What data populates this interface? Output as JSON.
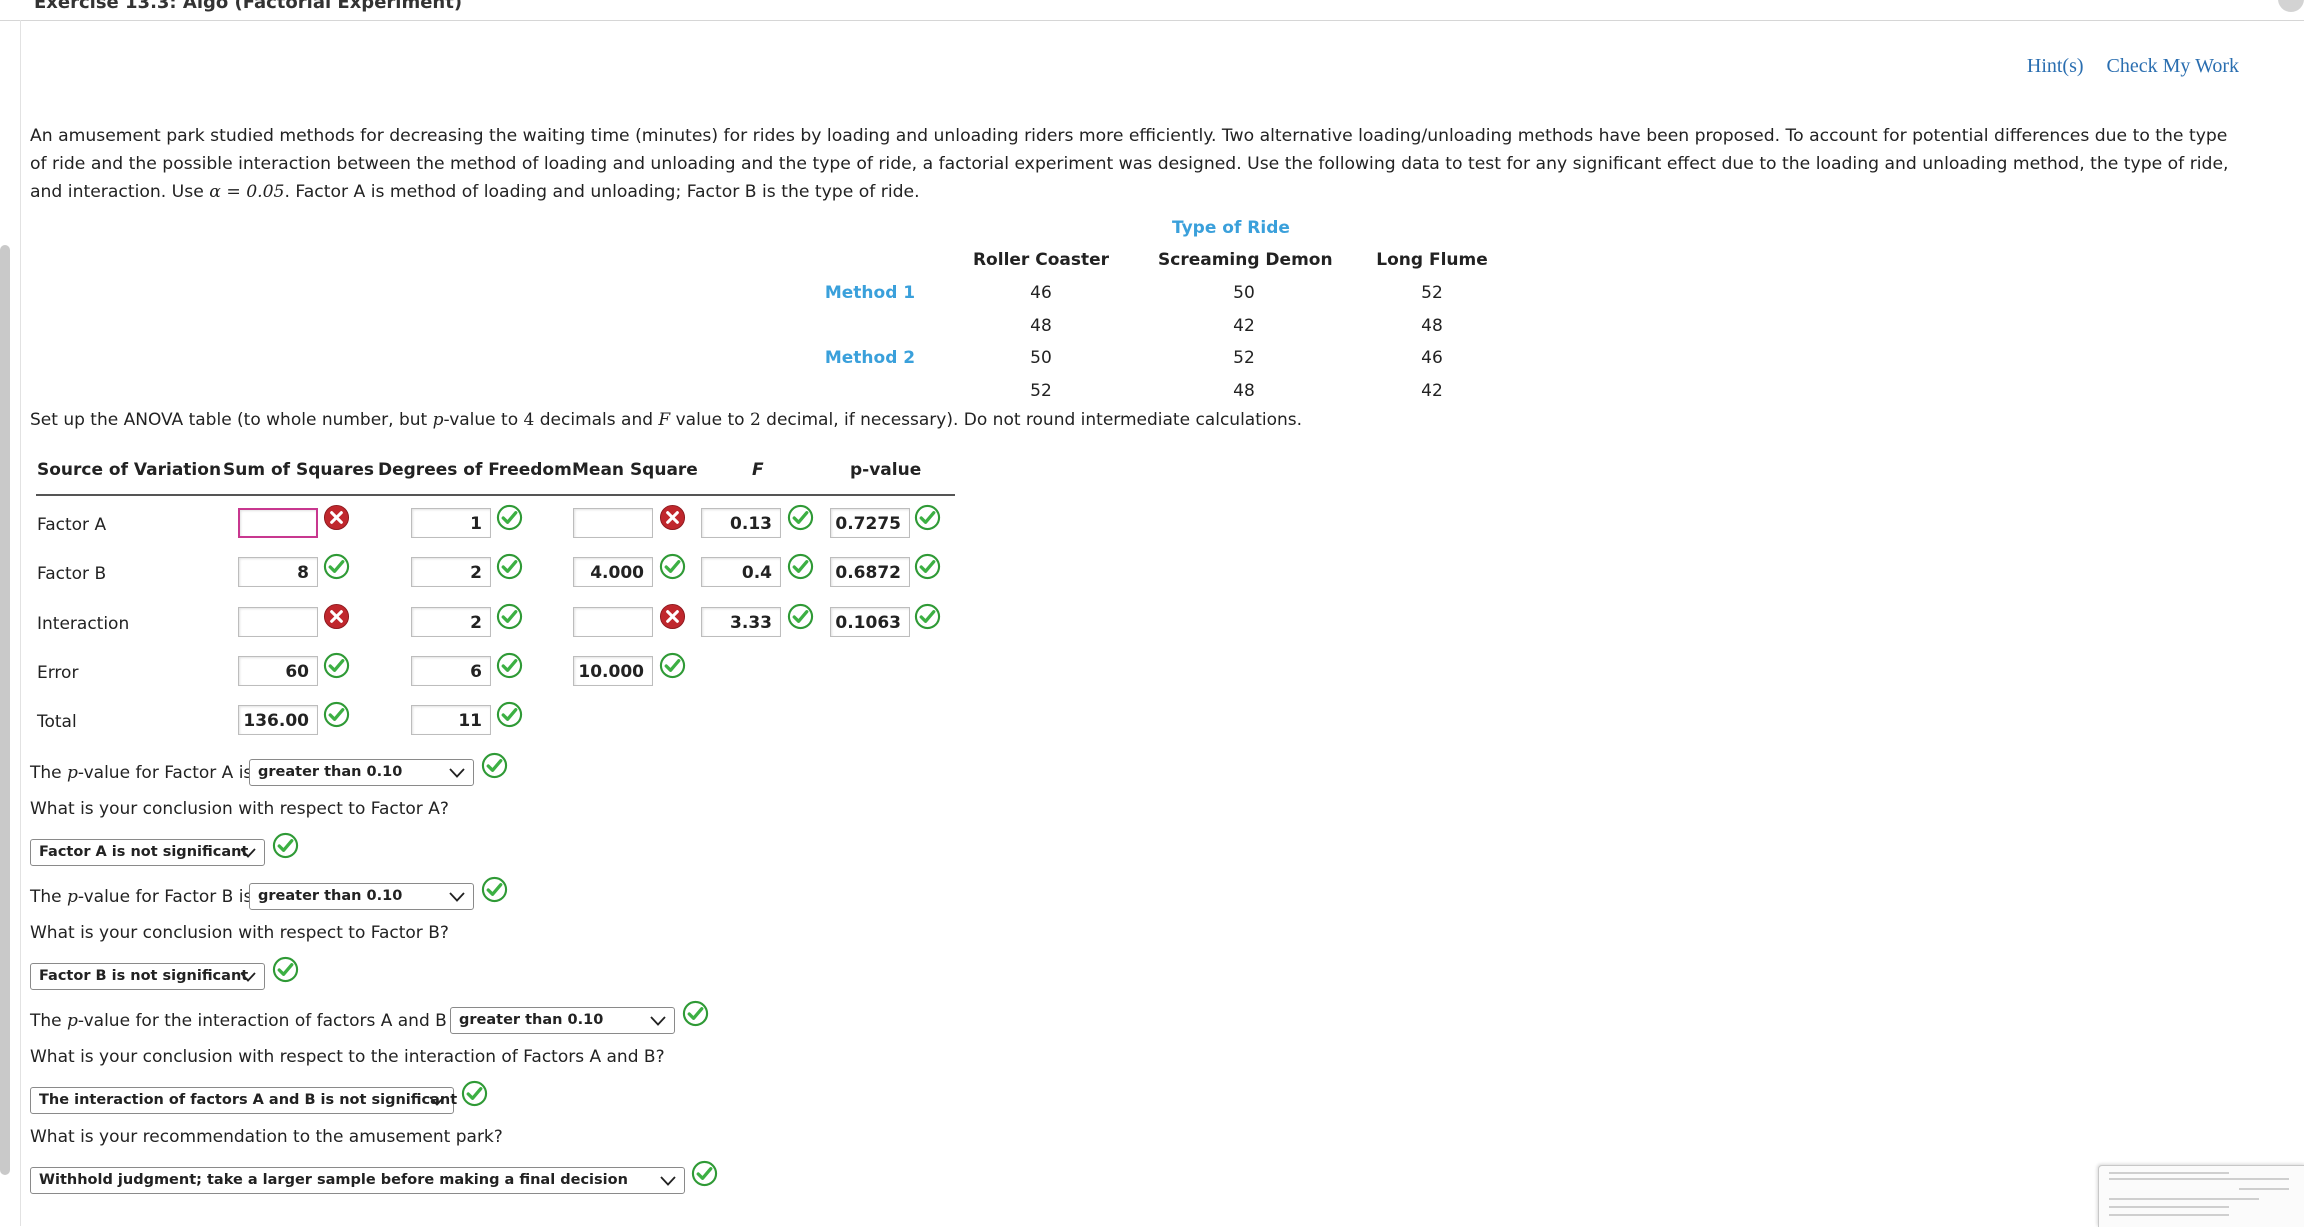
{
  "page_title": "Exercise 13.3: Algo (Factorial Experiment)",
  "links": {
    "hint": "Hint(s)",
    "check": "Check My Work"
  },
  "problem": {
    "text_1": "An amusement park studied methods for decreasing the waiting time (minutes) for rides by loading and unloading riders more efficiently. Two alternative loading/unloading methods have been proposed. To account for potential differences due to the type of ride and the possible interaction between the method of loading and unloading and the type of ride, a factorial experiment was designed. Use the following data to test for any significant effect due to the loading and unloading method, the type of ride, and interaction. Use ",
    "alpha": "α = 0.05",
    "text_2": ". Factor A is method of loading and unloading; Factor B is the type of ride."
  },
  "data_table": {
    "group_header": "Type of Ride",
    "columns": [
      "Roller Coaster",
      "Screaming Demon",
      "Long Flume"
    ],
    "rows": [
      {
        "method": "Method 1",
        "values": [
          "46",
          "50",
          "52"
        ]
      },
      {
        "method": "",
        "values": [
          "48",
          "42",
          "48"
        ]
      },
      {
        "method": "Method 2",
        "values": [
          "50",
          "52",
          "46"
        ]
      },
      {
        "method": "",
        "values": [
          "52",
          "48",
          "42"
        ]
      }
    ]
  },
  "setup": {
    "text_a": "Set up the ANOVA table (to whole number, but ",
    "p": "p",
    "text_b": "-value to ",
    "four": "4",
    "text_c": " decimals and ",
    "F": "F",
    "text_d": " value to ",
    "two": "2",
    "text_e": " decimal, if necessary). Do not round intermediate calculations."
  },
  "anova": {
    "headers": {
      "source": "Source of Variation",
      "ss": "Sum of Squares",
      "df": "Degrees of Freedom",
      "ms": "Mean Square",
      "f": "F",
      "p": "p-value"
    },
    "rows": [
      {
        "label": "Factor A",
        "ss": "",
        "ss_ok": false,
        "df": "1",
        "df_ok": true,
        "ms": "",
        "ms_ok": false,
        "f": "0.13",
        "f_ok": true,
        "p": "0.7275",
        "p_ok": true
      },
      {
        "label": "Factor B",
        "ss": "8",
        "ss_ok": true,
        "df": "2",
        "df_ok": true,
        "ms": "4.000",
        "ms_ok": true,
        "f": "0.4",
        "f_ok": true,
        "p": "0.6872",
        "p_ok": true
      },
      {
        "label": "Interaction",
        "ss": "",
        "ss_ok": false,
        "df": "2",
        "df_ok": true,
        "ms": "",
        "ms_ok": false,
        "f": "3.33",
        "f_ok": true,
        "p": "0.1063",
        "p_ok": true
      },
      {
        "label": "Error",
        "ss": "60",
        "ss_ok": true,
        "df": "6",
        "df_ok": true,
        "ms": "10.000",
        "ms_ok": true
      },
      {
        "label": "Total",
        "ss": "136.00",
        "ss_ok": true,
        "df": "11",
        "df_ok": true
      }
    ]
  },
  "questions": {
    "pa_text": "-value for Factor A is",
    "pa_sel": "greater than 0.10",
    "conc_a_q": "What is your conclusion with respect to Factor A?",
    "conc_a_sel": "Factor A is not significant",
    "pb_text": "-value for Factor B is",
    "pb_sel": "greater than 0.10",
    "conc_b_q": "What is your conclusion with respect to Factor B?",
    "conc_b_sel": "Factor B is not significant",
    "pi_text": "-value for the interaction of factors A and B is",
    "pi_sel": "greater than 0.10",
    "conc_i_q": "What is your conclusion with respect to the interaction of Factors A and B?",
    "conc_i_sel": "The interaction of factors A and B is not significant",
    "rec_q": "What is your recommendation to the amusement park?",
    "rec_sel": "Withhold judgment; take a larger sample before making a final decision",
    "the": "The",
    "p": "p",
    "the_lower": "the"
  },
  "colors": {
    "link": "#2a6eb0",
    "label_blue": "#3aa0db",
    "ok_green": "#3cb043",
    "bad_red": "#c0272d",
    "focus": "#c8378f"
  }
}
